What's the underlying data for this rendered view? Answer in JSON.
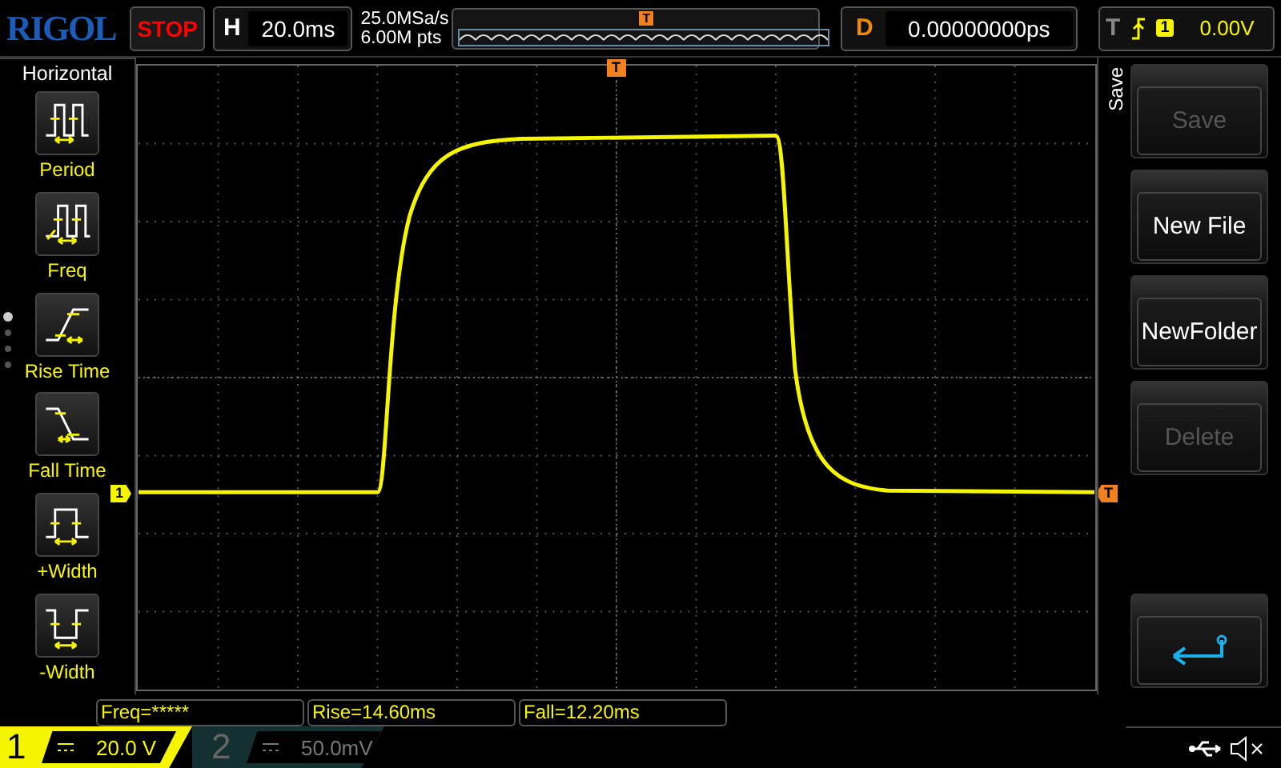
{
  "top_bar": {
    "logo": "RIGOL",
    "run_state": "STOP",
    "horizontal": {
      "label": "H",
      "timebase": "20.0ms"
    },
    "sample_rate": "25.0MSa/s",
    "memory_depth": "6.00M pts",
    "memory_trigger_marker": "T",
    "delay": {
      "label": "D",
      "value": "0.00000000ps"
    },
    "trigger": {
      "label": "T",
      "source": "1",
      "threshold": "0.00V"
    }
  },
  "side_menu": {
    "title": "Horizontal",
    "items": [
      {
        "label": "Period",
        "kind": "period"
      },
      {
        "label": "Freq",
        "kind": "freq"
      },
      {
        "label": "Rise Time",
        "kind": "rise"
      },
      {
        "label": "Fall Time",
        "kind": "fall"
      },
      {
        "label": "+Width",
        "kind": "pwidth"
      },
      {
        "label": "-Width",
        "kind": "nwidth"
      }
    ]
  },
  "plot": {
    "channel_marker": "1",
    "trigger_level_marker": "T",
    "trigger_position_marker": "T"
  },
  "measurements": [
    "Freq=*****",
    "Rise=14.60ms",
    "Fall=12.20ms"
  ],
  "channels": [
    {
      "number": "1",
      "scale": "20.0 V",
      "enabled": true
    },
    {
      "number": "2",
      "scale": "50.0mV",
      "enabled": false
    }
  ],
  "right_menu": {
    "title": "Save",
    "buttons": [
      {
        "kind": "text",
        "label": "Save",
        "disabled": true
      },
      {
        "kind": "text",
        "label": "New File",
        "disabled": false
      },
      {
        "kind": "text",
        "label": "NewFolder",
        "disabled": false
      },
      {
        "kind": "text",
        "label": "Delete",
        "disabled": true
      },
      {
        "kind": "back",
        "disabled": false
      }
    ]
  }
}
